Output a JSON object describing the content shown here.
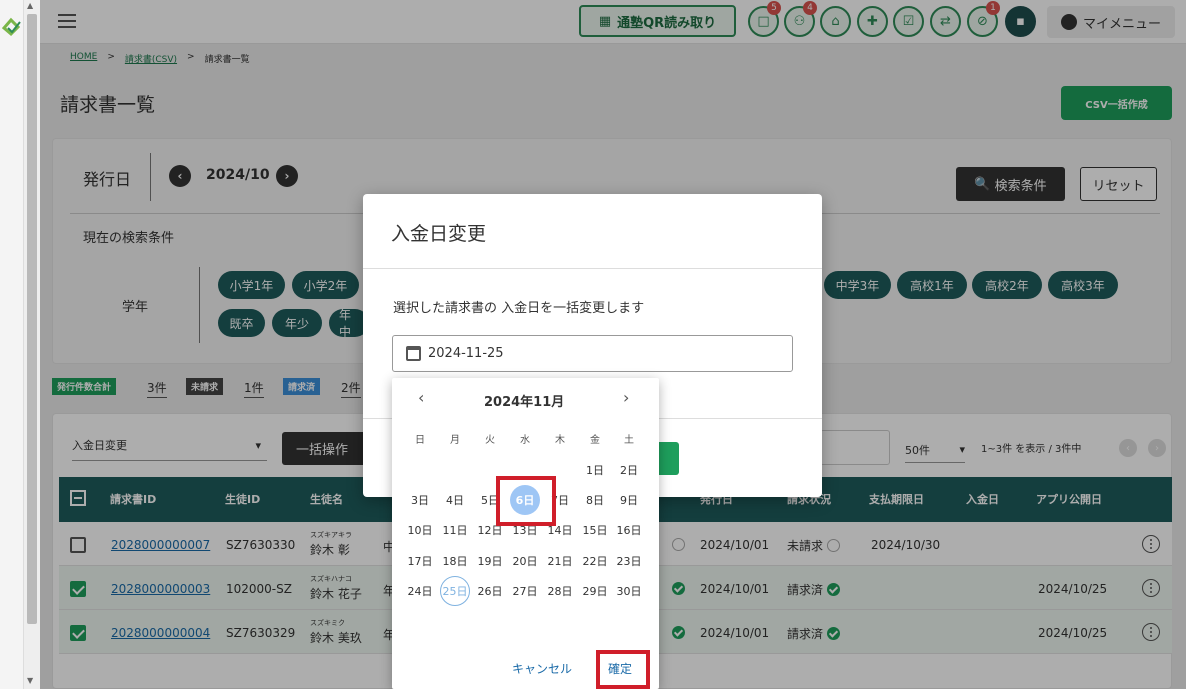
{
  "header": {
    "qr_button": "通塾QR読み取り",
    "icons": [
      {
        "name": "chat-icon",
        "badge": "5"
      },
      {
        "name": "users-icon",
        "badge": "4"
      },
      {
        "name": "bank-icon",
        "badge": ""
      },
      {
        "name": "gift-icon",
        "badge": ""
      },
      {
        "name": "checklist-icon",
        "badge": ""
      },
      {
        "name": "transfer-icon",
        "badge": ""
      },
      {
        "name": "block-icon",
        "badge": "1"
      },
      {
        "name": "message-icon",
        "badge": ""
      }
    ],
    "my_menu": "マイメニュー"
  },
  "breadcrumb": {
    "home": "HOME",
    "csv": "請求書(CSV)",
    "current": "請求書一覧"
  },
  "page": {
    "title": "請求書一覧",
    "csv_button": "CSV一括作成"
  },
  "search": {
    "issue_date_label": "発行日",
    "month": "2024/10",
    "search_button": "検索条件",
    "reset_button": "リセット",
    "current_conditions": "現在の検索条件",
    "grade_label": "学年",
    "grades_row1": [
      "小学1年",
      "小学2年",
      "中学3年",
      "高校1年",
      "高校2年",
      "高校3年"
    ],
    "grades_row2": [
      "既卒",
      "年少",
      "年中"
    ]
  },
  "summary": {
    "issued_total_label": "発行件数合計",
    "issued_total": "3件",
    "unbilled_label": "未請求",
    "unbilled": "1件",
    "billed_label": "請求済",
    "billed": "2件"
  },
  "table_toolbar": {
    "bulk_select": "入金日変更",
    "bulk_button": "一括操作",
    "per_page": "50件",
    "range": "1~3件 を表示 / 3件中"
  },
  "table": {
    "headers": {
      "invoice_id": "請求書ID",
      "student_id": "生徒ID",
      "student_name": "生徒名",
      "issue_date": "発行日",
      "status": "請求状況",
      "due_date": "支払期限日",
      "payment_date": "入金日",
      "app_date": "アプリ公開日"
    },
    "rows": [
      {
        "checked": false,
        "invoice_id": "2028000000007",
        "student_id": "SZ7630330",
        "kana": "スズキアキラ",
        "name": "鈴木 彰",
        "frag": "中",
        "issue_date": "2024/10/01",
        "status": "未請求",
        "due_date": "2024/10/30",
        "app_date": ""
      },
      {
        "checked": true,
        "invoice_id": "2028000000003",
        "student_id": "102000-SZ",
        "kana": "スズキハナコ",
        "name": "鈴木 花子",
        "frag": "年",
        "issue_date": "2024/10/01",
        "status": "請求済",
        "due_date": "",
        "app_date": "2024/10/25"
      },
      {
        "checked": true,
        "invoice_id": "2028000000004",
        "student_id": "SZ7630329",
        "kana": "スズキミク",
        "name": "鈴木 美玖",
        "frag": "年",
        "issue_date": "2024/10/01",
        "status": "請求済",
        "due_date": "",
        "app_date": "2024/10/25"
      }
    ]
  },
  "modal": {
    "title": "入金日変更",
    "description": "選択した請求書の 入金日を一括変更します",
    "date_value": "2024-11-25"
  },
  "calendar": {
    "month_label": "2024年11月",
    "weekdays": [
      "日",
      "月",
      "火",
      "水",
      "木",
      "金",
      "土"
    ],
    "week1": [
      "1日",
      "2日"
    ],
    "week2": [
      "3日",
      "4日",
      "5日",
      "6日",
      "7日",
      "8日",
      "9日"
    ],
    "week3": [
      "10日",
      "11日",
      "12日",
      "13日",
      "14日",
      "15日",
      "16日"
    ],
    "week4": [
      "17日",
      "18日",
      "19日",
      "20日",
      "21日",
      "22日",
      "23日"
    ],
    "week5": [
      "24日",
      "25日",
      "26日",
      "27日",
      "28日",
      "29日",
      "30日"
    ],
    "cancel": "キャンセル",
    "confirm": "確定"
  },
  "colors": {
    "brand_green": "#1e9e5c",
    "teal_dark": "#1e5c5c",
    "highlight_red": "#d01e2a",
    "selected_day": "#9ec6f5"
  }
}
